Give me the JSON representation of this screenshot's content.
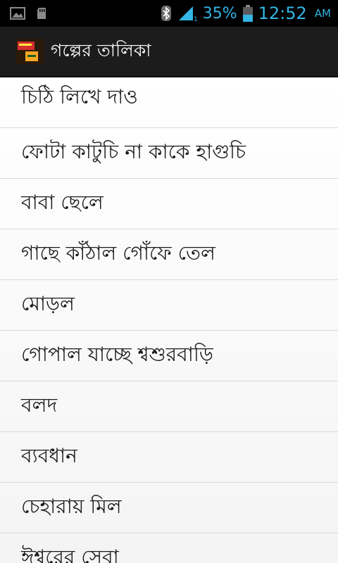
{
  "status_bar": {
    "left_icons": [
      "image-icon",
      "sd-card-icon"
    ],
    "right_icons": [
      "bluetooth-icon",
      "signal-icon",
      "battery-icon"
    ],
    "battery_percent": "35%",
    "time": "12:52",
    "ampm": "AM",
    "accent_color": "#33b5e5"
  },
  "action_bar": {
    "logo_icon": "app-logo-icon",
    "title": "গল্পের তালিকা"
  },
  "stories": [
    "চিঠি লিখে দাও",
    "ফোটা কাটুচি না কাকে হাগুচি",
    "বাবা ছেলে",
    "গাছে কাঁঠাল গোঁফে তেল",
    "মোড়ল",
    "গোপাল যাচ্ছে শ্বশুরবাড়ি",
    "বলদ",
    "ব্যবধান",
    "চেহারায় মিল",
    "ঈশ্বরের সেবা"
  ]
}
